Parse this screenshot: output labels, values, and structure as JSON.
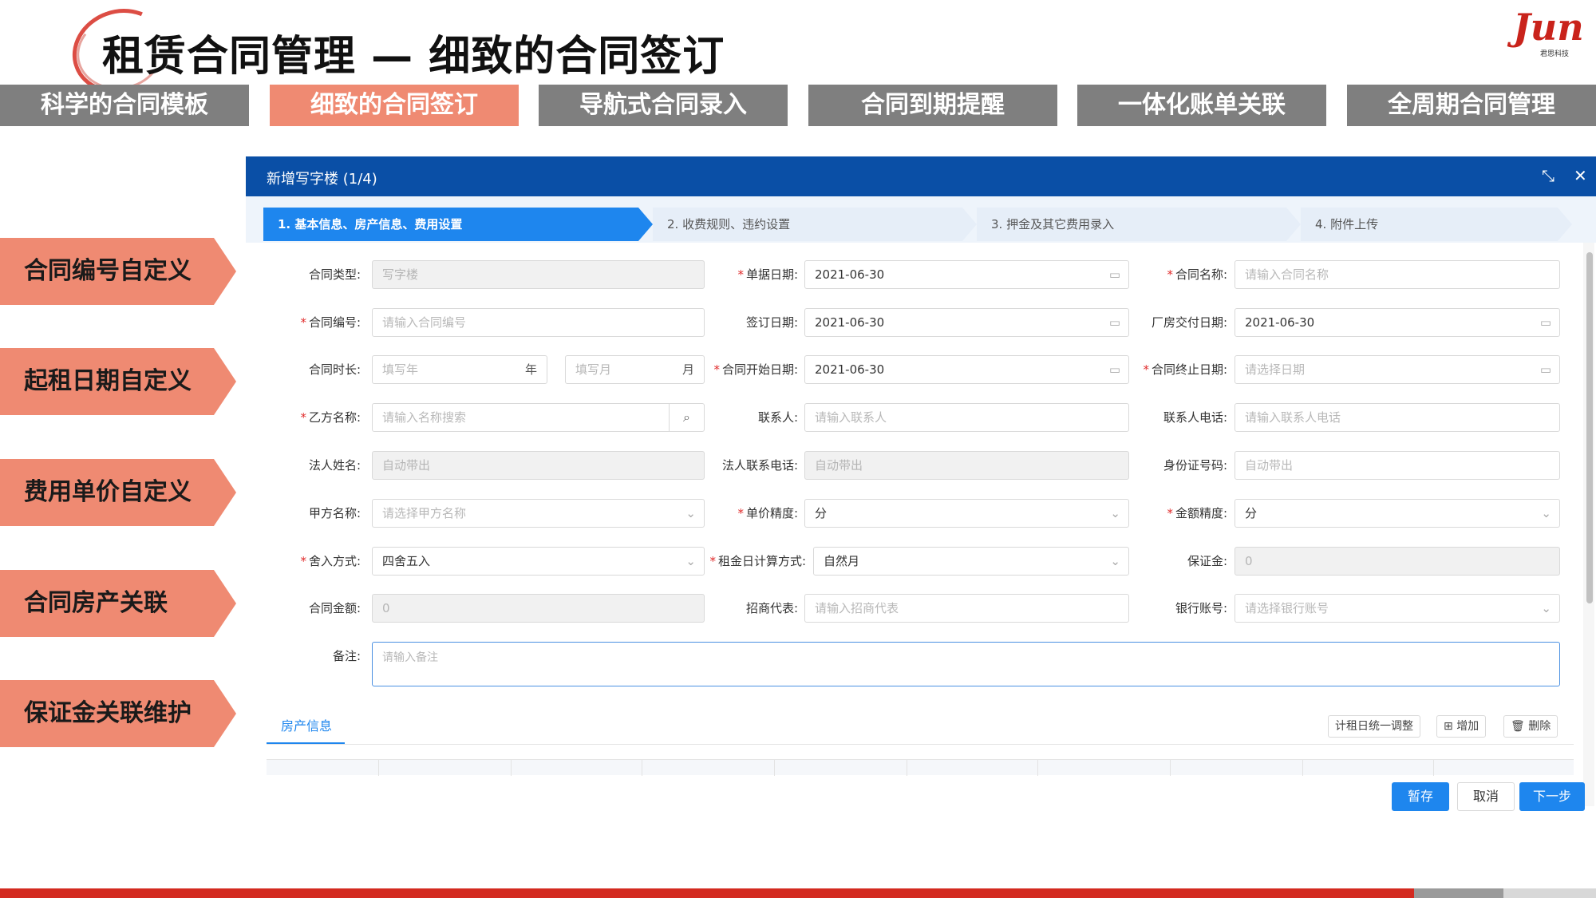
{
  "slide": {
    "title": "租赁合同管理 — 细致的合同签订",
    "logo_text": "Jun",
    "logo_sub": "君思科技"
  },
  "feature_tabs": [
    {
      "label": "科学的合同模板",
      "active": false
    },
    {
      "label": "细致的合同签订",
      "active": true
    },
    {
      "label": "导航式合同录入",
      "active": false
    },
    {
      "label": "合同到期提醒",
      "active": false
    },
    {
      "label": "一体化账单关联",
      "active": false
    },
    {
      "label": "全周期合同管理",
      "active": false
    }
  ],
  "side_labels": [
    "合同编号自定义",
    "起租日期自定义",
    "费用单价自定义",
    "合同房产关联",
    "保证金关联维护"
  ],
  "modal": {
    "title": "新增写字楼 (1/4)",
    "maximize_icon": "⤡",
    "close_icon": "✕",
    "steps": [
      {
        "label": "1. 基本信息、房产信息、费用设置",
        "active": true
      },
      {
        "label": "2. 收费规则、违约设置",
        "active": false
      },
      {
        "label": "3. 押金及其它费用录入",
        "active": false
      },
      {
        "label": "4. 附件上传",
        "active": false
      }
    ],
    "form": {
      "contract_type": {
        "label": "合同类型:",
        "value": "写字楼"
      },
      "doc_date": {
        "label": "单据日期:",
        "value": "2021-06-30"
      },
      "contract_name": {
        "label": "合同名称:",
        "placeholder": "请输入合同名称"
      },
      "contract_no": {
        "label": "合同编号:",
        "placeholder": "请输入合同编号"
      },
      "sign_date": {
        "label": "签订日期:",
        "value": "2021-06-30"
      },
      "delivery_date": {
        "label": "厂房交付日期:",
        "value": "2021-06-30"
      },
      "duration": {
        "label": "合同时长:",
        "year_placeholder": "填写年",
        "year_suffix": "年",
        "month_placeholder": "填写月",
        "month_suffix": "月"
      },
      "start_date": {
        "label": "合同开始日期:",
        "value": "2021-06-30"
      },
      "end_date": {
        "label": "合同终止日期:",
        "placeholder": "请选择日期"
      },
      "party_b": {
        "label": "乙方名称:",
        "placeholder": "请输入名称搜索"
      },
      "contact": {
        "label": "联系人:",
        "placeholder": "请输入联系人"
      },
      "contact_phone": {
        "label": "联系人电话:",
        "placeholder": "请输入联系人电话"
      },
      "legal_name": {
        "label": "法人姓名:",
        "value": "自动带出"
      },
      "legal_phone": {
        "label": "法人联系电话:",
        "value": "自动带出"
      },
      "id_no": {
        "label": "身份证号码:",
        "value": "自动带出"
      },
      "party_a": {
        "label": "甲方名称:",
        "placeholder": "请选择甲方名称"
      },
      "unit_precision": {
        "label": "单价精度:",
        "value": "分"
      },
      "amount_precision": {
        "label": "金额精度:",
        "value": "分"
      },
      "rounding": {
        "label": "舍入方式:",
        "value": "四舍五入"
      },
      "rent_calc": {
        "label": "租金日计算方式:",
        "value": "自然月"
      },
      "deposit": {
        "label": "保证金:",
        "value": "0"
      },
      "contract_amount": {
        "label": "合同金额:",
        "value": "0"
      },
      "agent": {
        "label": "招商代表:",
        "placeholder": "请输入招商代表"
      },
      "bank_account": {
        "label": "银行账号:",
        "placeholder": "请选择银行账号"
      },
      "remark": {
        "label": "备注:",
        "placeholder": "请输入备注"
      }
    },
    "property_tab": "房产信息",
    "actions": {
      "adjust": "计租日统一调整",
      "add": "增加",
      "delete": "删除"
    },
    "footer": {
      "save": "暂存",
      "cancel": "取消",
      "next": "下一步"
    }
  },
  "colors": {
    "accent": "#1e86ee",
    "header_blue": "#0a4fa6",
    "salmon": "#ef8a72",
    "tab_gray": "#7f7f7f",
    "brand_red": "#c9231b"
  }
}
